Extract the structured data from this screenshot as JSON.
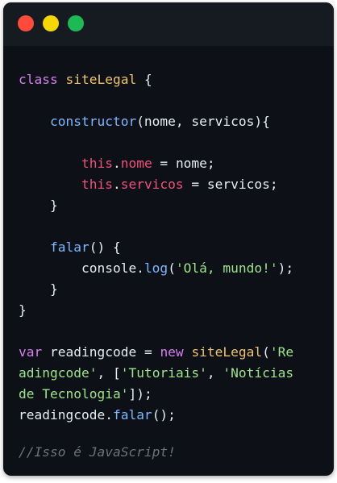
{
  "window": {
    "controls": [
      "close",
      "minimize",
      "maximize"
    ]
  },
  "code": {
    "lines": [
      [
        "class",
        " ",
        "siteLegal",
        " {"
      ],
      [
        ""
      ],
      [
        "    ",
        "constructor",
        "(nome, servicos){"
      ],
      [
        ""
      ],
      [
        "        ",
        "this",
        ".",
        "nome",
        " = ",
        "nome;"
      ],
      [
        "        ",
        "this",
        ".",
        "servicos",
        " = ",
        "servicos;"
      ],
      [
        "    }"
      ],
      [
        ""
      ],
      [
        "    ",
        "falar",
        "() {"
      ],
      [
        "        console.",
        "log",
        "(",
        "'Olá, mundo!'",
        ");"
      ],
      [
        "    }"
      ],
      [
        "}"
      ],
      [
        ""
      ],
      [
        "var",
        " readingcode = ",
        "new",
        " ",
        "siteLegal",
        "(",
        "'Re"
      ],
      [
        "adingcode'",
        ", [",
        "'Tutoriais'",
        ", ",
        "'Notícias"
      ],
      [
        "de Tecnologia'",
        "]);"
      ],
      [
        "readingcode.",
        "falar",
        "();"
      ],
      [
        ""
      ],
      [
        "//Isso é JavaScript!"
      ]
    ],
    "types": [
      [
        "kw",
        "op",
        "cls",
        "op"
      ],
      [
        "op"
      ],
      [
        "op",
        "fn",
        "op"
      ],
      [
        "op"
      ],
      [
        "op",
        "this",
        "op",
        "prop",
        "op",
        "op"
      ],
      [
        "op",
        "this",
        "op",
        "prop",
        "op",
        "op"
      ],
      [
        "op"
      ],
      [
        "op"
      ],
      [
        "op",
        "fn",
        "op"
      ],
      [
        "op",
        "fn",
        "op",
        "str",
        "op"
      ],
      [
        "op"
      ],
      [
        "op"
      ],
      [
        "op"
      ],
      [
        "kw",
        "op",
        "kw",
        "op",
        "cls",
        "op",
        "str"
      ],
      [
        "str",
        "op",
        "str",
        "op",
        "str"
      ],
      [
        "str",
        "op"
      ],
      [
        "op",
        "fn",
        "op"
      ],
      [
        "op"
      ],
      [
        "cmt"
      ]
    ]
  },
  "colors": {
    "background": "#0d1117",
    "titlebar": "#161b22",
    "close": "#ff4b3c",
    "minimize": "#f5d800",
    "maximize": "#1db954"
  }
}
